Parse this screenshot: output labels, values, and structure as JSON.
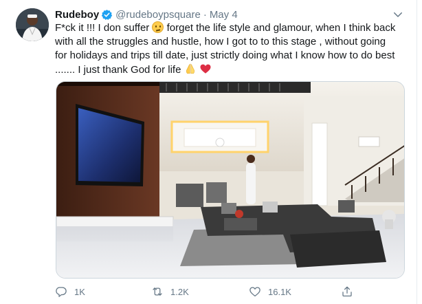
{
  "tweet": {
    "author_name": "Rudeboy",
    "handle": "@rudeboypsquare",
    "separator": "·",
    "date": "May 4",
    "text_lines": [
      "F*ck it !!! I don suffer",
      "forget the life style and glamour, when I think back",
      "with all the struggles and hustle, how I got to to this stage , without going",
      "for holidays and trips till date, just strictly doing what I know how to do best",
      "....... I just thank God for life"
    ],
    "media": {
      "icon": "photo-living-room"
    }
  },
  "actions": {
    "reply_count": "1K",
    "retweet_count": "1.2K",
    "like_count": "16.1K"
  },
  "colors": {
    "accent": "#1da1f2",
    "secondary_text": "#657786",
    "heart": "#dd2e44"
  }
}
